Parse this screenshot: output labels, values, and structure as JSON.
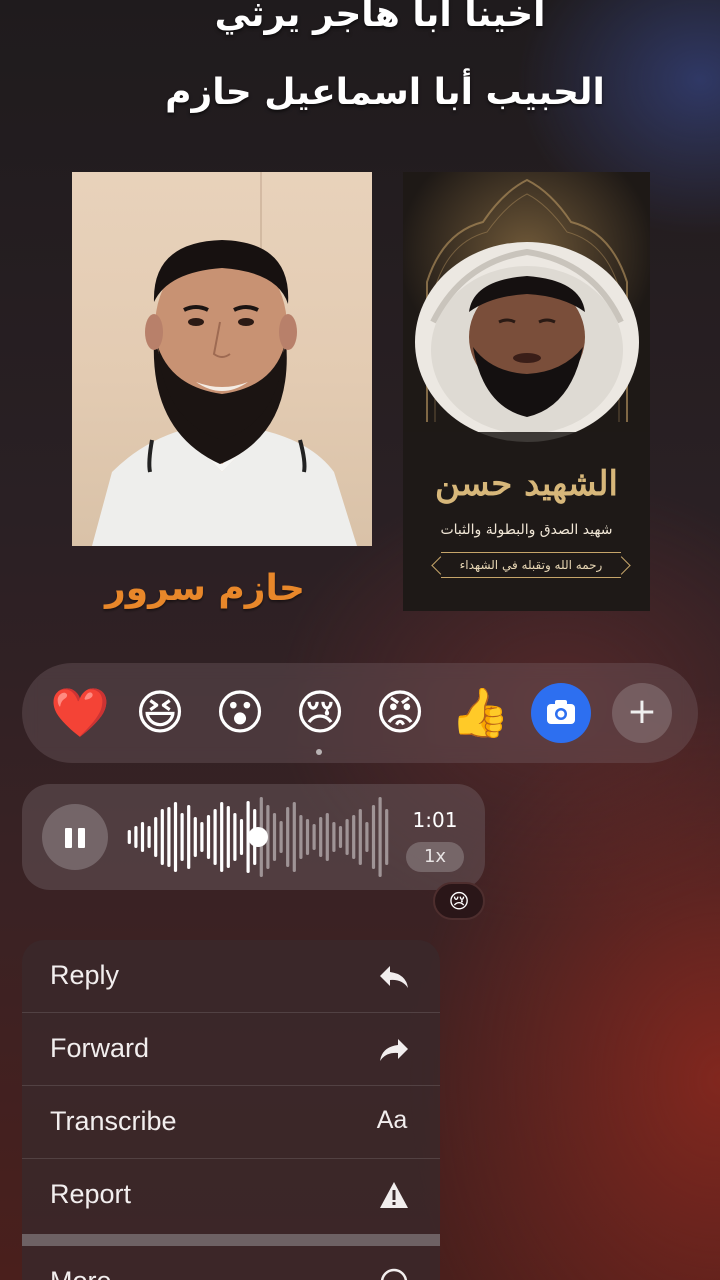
{
  "header": {
    "line1": "أخينا أبا هاجر يرثي",
    "line2": "الحبيب أبا اسماعيل حازم"
  },
  "photos": {
    "left_caption": "حازم سرور",
    "poster_title": "الشهيد حسن",
    "poster_subtitle": "شهيد الصدق والبطولة والثبات",
    "poster_tagline": "رحمه الله وتقبله في الشهداء"
  },
  "reactions": {
    "items": [
      {
        "emoji": "❤️",
        "icon": "red-heart"
      },
      {
        "emoji": "😆",
        "icon": "laughing-face"
      },
      {
        "emoji": "😮",
        "icon": "surprised-face"
      },
      {
        "emoji": "😢",
        "icon": "crying-face"
      },
      {
        "emoji": "😡",
        "icon": "angry-face"
      },
      {
        "emoji": "👍",
        "icon": "thumbs-up"
      }
    ],
    "camera_icon": "camera-icon",
    "plus_label": "+"
  },
  "voice_message": {
    "duration": "1:01",
    "speed": "1x",
    "progress": 0.5,
    "reaction": "😢"
  },
  "menu": {
    "items": [
      {
        "label": "Reply",
        "icon": "↩",
        "icon_name": "reply-icon"
      },
      {
        "label": "Forward",
        "icon": "↪",
        "icon_name": "forward-icon"
      },
      {
        "label": "Transcribe",
        "icon": "Aa",
        "icon_name": "transcribe-icon"
      },
      {
        "label": "Report",
        "icon": "⚠",
        "icon_name": "report-icon"
      }
    ],
    "more_label": "More"
  },
  "colors": {
    "caption_orange": "#e8872a",
    "poster_gold": "#d7b77a",
    "camera_blue": "#2d6ff0"
  }
}
